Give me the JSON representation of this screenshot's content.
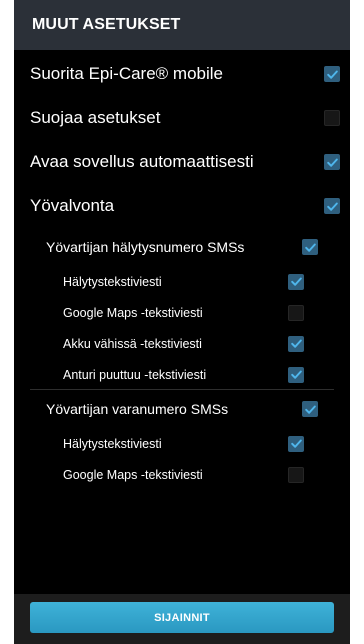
{
  "header": {
    "title": "MUUT ASETUKSET"
  },
  "settings": [
    {
      "label": "Suorita Epi-Care® mobile",
      "checked": true
    },
    {
      "label": "Suojaa asetukset",
      "checked": false
    },
    {
      "label": "Avaa sovellus automaattisesti",
      "checked": true
    },
    {
      "label": "Yövalvonta",
      "checked": true
    }
  ],
  "primary_sms": {
    "label": "Yövartijan hälytysnumero SMSs",
    "checked": true,
    "items": [
      {
        "label": "Hälytystekstiviesti",
        "checked": true
      },
      {
        "label": "Google Maps -tekstiviesti",
        "checked": false
      },
      {
        "label": "Akku vähissä -tekstiviesti",
        "checked": true
      },
      {
        "label": "Anturi puuttuu -tekstiviesti",
        "checked": true
      }
    ]
  },
  "backup_sms": {
    "label": "Yövartijan varanumero SMSs",
    "checked": true,
    "items": [
      {
        "label": "Hälytystekstiviesti",
        "checked": true
      },
      {
        "label": "Google Maps -tekstiviesti",
        "checked": false
      }
    ]
  },
  "footer": {
    "button_label": "SIJAINNIT"
  },
  "colors": {
    "checkbox_checked": "#2f5f7e",
    "check_mark": "#4fb6ec",
    "button": "#34a8d0",
    "header_bg": "#2b3038"
  },
  "icons": {
    "check": "checkmark-icon"
  }
}
